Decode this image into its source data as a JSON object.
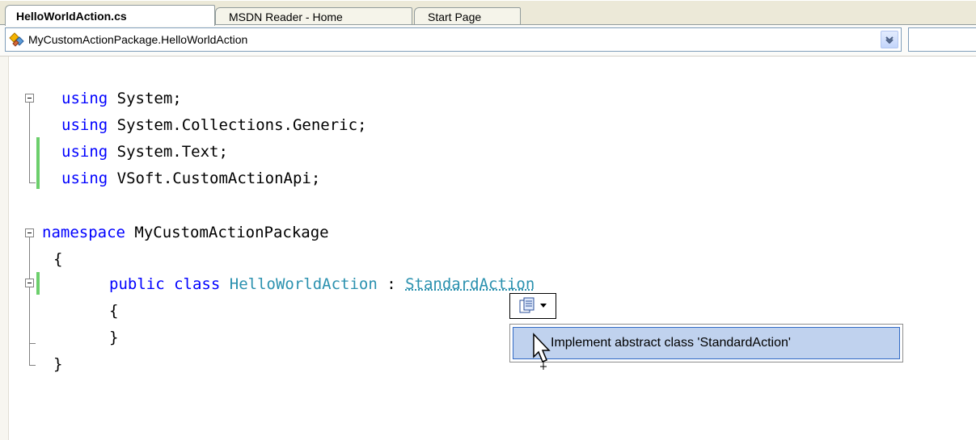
{
  "tabs": [
    {
      "label": "HelloWorldAction.cs",
      "active": true
    },
    {
      "label": "MSDN Reader - Home",
      "active": false
    },
    {
      "label": "Start Page",
      "active": false
    }
  ],
  "navbar": {
    "type_selector_value": "MyCustomActionPackage.HelloWorldAction",
    "member_selector_value": ""
  },
  "code": {
    "lines": [
      {
        "kw": "using",
        "rest": " System;"
      },
      {
        "kw": "using",
        "rest": " System.Collections.Generic;"
      },
      {
        "kw": "using",
        "rest": " System.Text;"
      },
      {
        "kw": "using",
        "rest": " VSoft.CustomActionApi;"
      },
      {
        "kw": "namespace",
        "rest": " MyCustomActionPackage"
      },
      {
        "text": "{"
      },
      {
        "kw1": "public",
        "kw2": "class",
        "class_name": "HelloWorldAction",
        "sep": " : ",
        "base_name": "StandardAction"
      },
      {
        "text": "{"
      },
      {
        "text": "}"
      },
      {
        "text": "}"
      }
    ]
  },
  "smart_tag": {
    "menu_item": "Implement abstract class 'StandardAction'"
  },
  "colors": {
    "keyword": "#0000ff",
    "type_name": "#2b91af",
    "menu_highlight": "#c0d2ee",
    "change_marker": "#6ccf6c"
  }
}
